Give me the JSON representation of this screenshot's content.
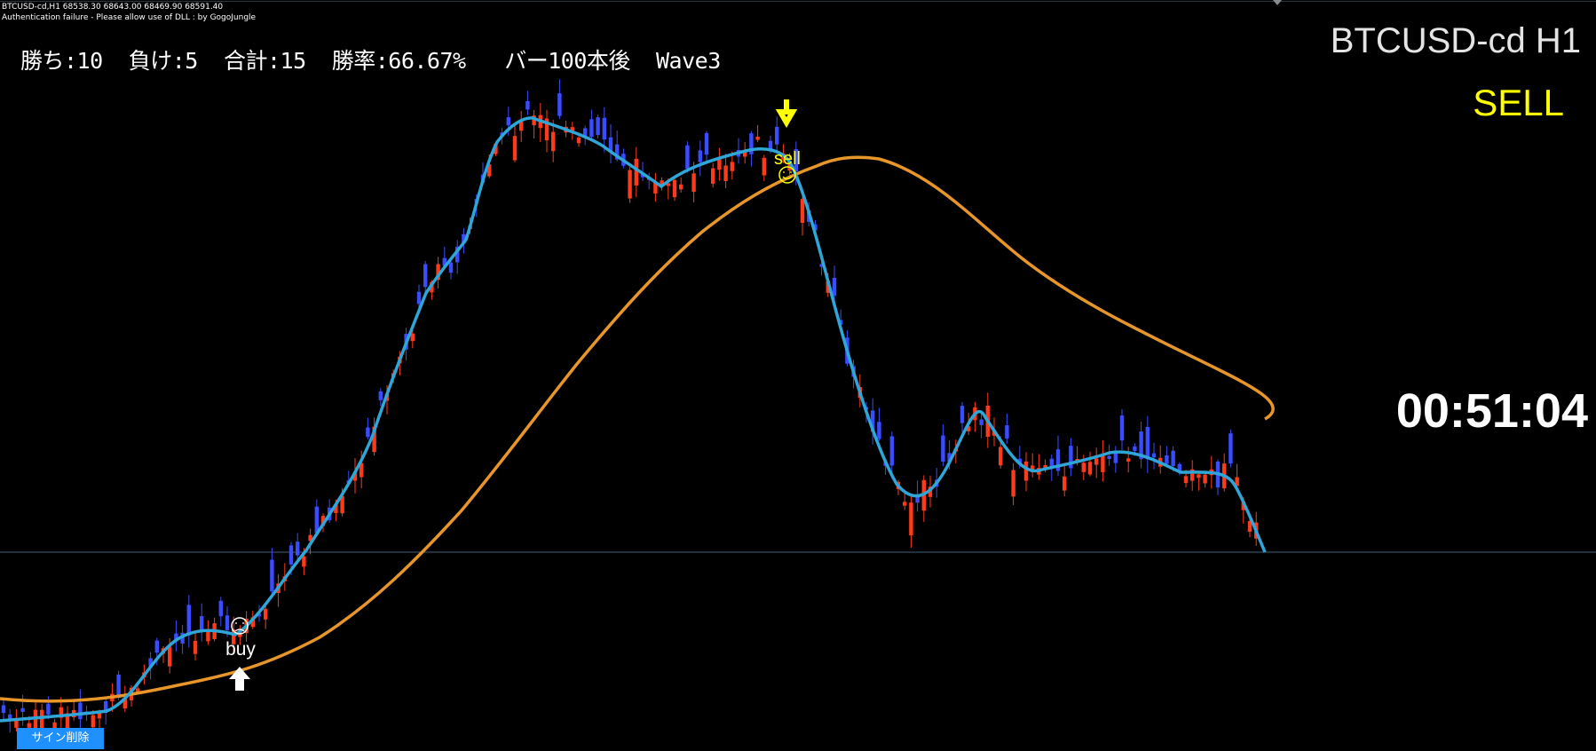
{
  "chart_info": {
    "ohlc_line": "BTCUSD-cd,H1  68538.30 68643.00 68469.90 68591.40",
    "auth_line": "Authentication failure - Please allow use of DLL : by GogoJungle"
  },
  "stats_text": "勝ち:10  負け:5  合計:15  勝率:66.67%   バー100本後  Wave3",
  "symbol_label": "BTCUSD-cd H1",
  "signal_label": "SELL",
  "countdown": "00:51:04",
  "delete_button_label": "サイン削除",
  "markers": {
    "buy_label": "buy",
    "sell_label": "sell"
  },
  "colors": {
    "background": "#000000",
    "bull_candle": "#3a4cff",
    "bear_candle": "#ff3a1a",
    "fast_ma": "#2fa6d8",
    "slow_ma": "#e8962a",
    "signal": "#ffff00",
    "price_line": "#41607a",
    "button": "#1e90ff"
  },
  "icons": {
    "buy": "white-up-arrow-icon",
    "sell": "yellow-down-arrow-icon"
  }
}
